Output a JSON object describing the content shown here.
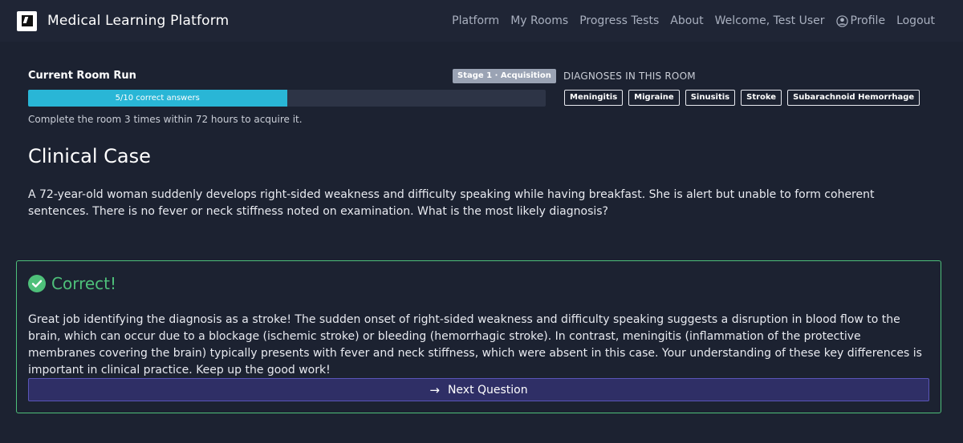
{
  "nav": {
    "brand": "Medical Learning Platform",
    "links": [
      "Platform",
      "My Rooms",
      "Progress Tests",
      "About"
    ],
    "welcome": "Welcome, Test User",
    "profile": "Profile",
    "logout": "Logout"
  },
  "run": {
    "title": "Current Room Run",
    "stage": "Stage 1 · Acquisition",
    "progress_label": "5/10 correct answers",
    "progress_fraction": 0.5,
    "note": "Complete the room 3 times within 72 hours to acquire it."
  },
  "diagnoses": {
    "label": "DIAGNOSES IN THIS ROOM",
    "items": [
      "Meningitis",
      "Migraine",
      "Sinusitis",
      "Stroke",
      "Subarachnoid Hemorrhage"
    ]
  },
  "case": {
    "heading": "Clinical Case",
    "text": "A 72-year-old woman suddenly develops right-sided weakness and difficulty speaking while having breakfast. She is alert but unable to form coherent sentences. There is no fever or neck stiffness noted on examination. What is the most likely diagnosis?"
  },
  "feedback": {
    "title": "Correct!",
    "text": "Great job identifying the diagnosis as a stroke! The sudden onset of right-sided weakness and difficulty speaking suggests a disruption in blood flow to the brain, which can occur due to a blockage (ischemic stroke) or bleeding (hemorrhagic stroke). In contrast, meningitis (inflammation of the protective membranes covering the brain) typically presents with fever and neck stiffness, which were absent in this case. Your understanding of these key differences is important in clinical practice. Keep up the good work!",
    "next_label": "Next Question",
    "accent": "#4ec07a"
  },
  "colors": {
    "background": "#1c2231",
    "progress_fill": "#29b6d6",
    "button_bg": "#2f2f66"
  }
}
